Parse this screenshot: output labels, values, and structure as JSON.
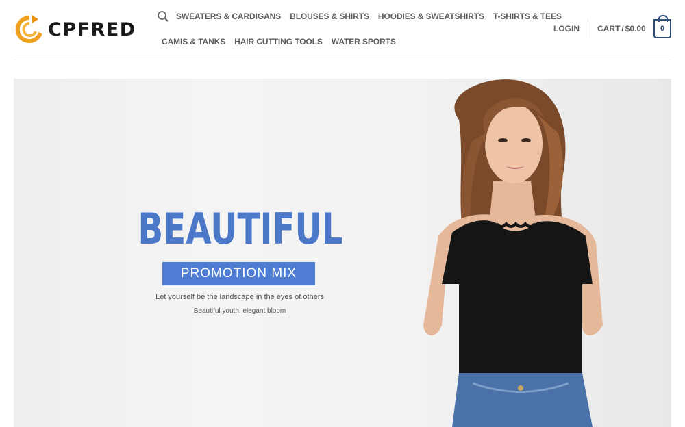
{
  "brand": {
    "name": "CPFRED",
    "accent": "#f0a020"
  },
  "search": {
    "icon": "search-icon"
  },
  "nav": {
    "row1": [
      "SWEATERS & CARDIGANS",
      "BLOUSES & SHIRTS",
      "HOODIES & SWEATSHIRTS",
      "T-SHIRTS & TEES"
    ],
    "row2": [
      "CAMIS & TANKS",
      "HAIR CUTTING TOOLS",
      "WATER SPORTS"
    ]
  },
  "account": {
    "login": "LOGIN"
  },
  "cart": {
    "label": "CART",
    "separator": "/",
    "total": "$0.00",
    "count": "0",
    "color": "#2b4d78"
  },
  "banner": {
    "title": "BEAUTIFUL",
    "promo": "PROMOTION MIX",
    "tagline": "Let yourself be the landscape in the eyes of others",
    "subtagline": "Beautiful youth, elegant bloom",
    "title_color": "#4b78c9",
    "promo_color": "#4e7dd3"
  }
}
